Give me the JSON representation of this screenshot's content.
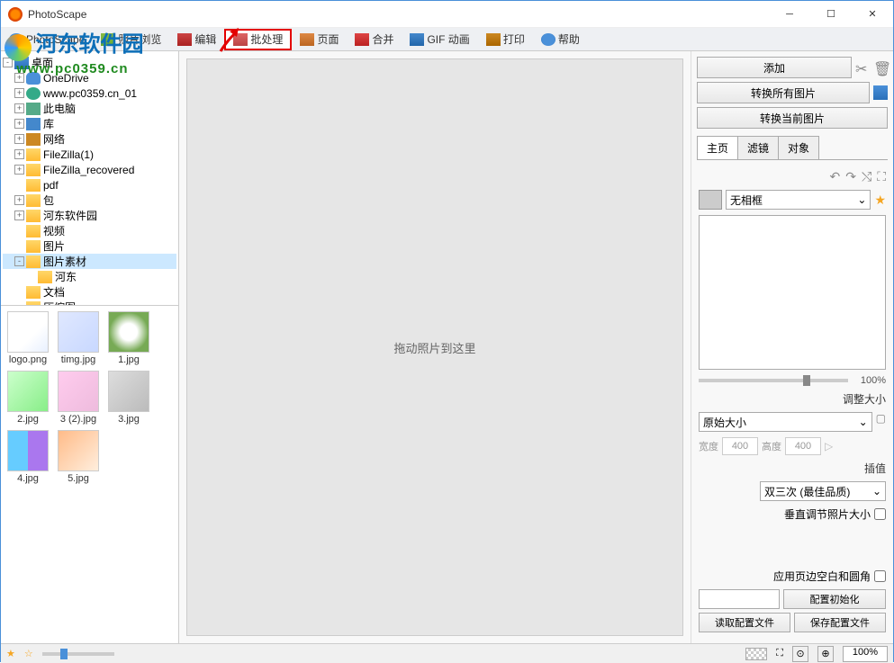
{
  "app": {
    "title": "PhotoScape"
  },
  "watermark": {
    "line1": "河东软件园",
    "line2": "www.pc0359.cn"
  },
  "toolbar": {
    "tabs": [
      {
        "label": "PhotoScape",
        "icon": "globe"
      },
      {
        "label": "照片浏览",
        "icon": "photo"
      },
      {
        "label": "编辑",
        "icon": "edit"
      },
      {
        "label": "批处理",
        "icon": "batch",
        "highlighted": true
      },
      {
        "label": "页面",
        "icon": "page"
      },
      {
        "label": "合并",
        "icon": "merge"
      },
      {
        "label": "GIF 动画",
        "icon": "gif"
      },
      {
        "label": "打印",
        "icon": "print"
      },
      {
        "label": "帮助",
        "icon": "help"
      }
    ]
  },
  "tree": [
    {
      "depth": 0,
      "exp": "-",
      "icon": "desktop",
      "label": "桌面"
    },
    {
      "depth": 1,
      "exp": "+",
      "icon": "cloud",
      "label": "OneDrive"
    },
    {
      "depth": 1,
      "exp": "+",
      "icon": "user",
      "label": "www.pc0359.cn_01"
    },
    {
      "depth": 1,
      "exp": "+",
      "icon": "pc",
      "label": "此电脑"
    },
    {
      "depth": 1,
      "exp": "+",
      "icon": "lib",
      "label": "库"
    },
    {
      "depth": 1,
      "exp": "+",
      "icon": "net",
      "label": "网络"
    },
    {
      "depth": 1,
      "exp": "+",
      "icon": "folder",
      "label": "FileZilla(1)"
    },
    {
      "depth": 1,
      "exp": "+",
      "icon": "folder",
      "label": "FileZilla_recovered"
    },
    {
      "depth": 1,
      "exp": "",
      "icon": "folder",
      "label": "pdf"
    },
    {
      "depth": 1,
      "exp": "+",
      "icon": "folder",
      "label": "包"
    },
    {
      "depth": 1,
      "exp": "+",
      "icon": "folder",
      "label": "河东软件园"
    },
    {
      "depth": 1,
      "exp": "",
      "icon": "folder",
      "label": "视频"
    },
    {
      "depth": 1,
      "exp": "",
      "icon": "folder",
      "label": "图片"
    },
    {
      "depth": 1,
      "exp": "-",
      "icon": "folder",
      "label": "图片素材",
      "selected": true
    },
    {
      "depth": 2,
      "exp": "",
      "icon": "folder",
      "label": "河东"
    },
    {
      "depth": 1,
      "exp": "",
      "icon": "folder",
      "label": "文档"
    },
    {
      "depth": 1,
      "exp": "",
      "icon": "folder",
      "label": "压缩图"
    }
  ],
  "thumbs": [
    {
      "label": "logo.png"
    },
    {
      "label": "timg.jpg"
    },
    {
      "label": "1.jpg"
    },
    {
      "label": "2.jpg"
    },
    {
      "label": "3 (2).jpg"
    },
    {
      "label": "3.jpg"
    },
    {
      "label": "4.jpg"
    },
    {
      "label": "5.jpg"
    }
  ],
  "canvas": {
    "placeholder": "拖动照片到这里"
  },
  "right": {
    "add": "添加",
    "convert_all": "转换所有图片",
    "convert_current": "转换当前图片",
    "subtabs": {
      "home": "主页",
      "filter": "滤镜",
      "object": "对象"
    },
    "frame": {
      "label": "无相框"
    },
    "opacity_value": "100%",
    "resize": {
      "title": "调整大小",
      "mode": "原始大小",
      "width_label": "宽度",
      "width_value": "400",
      "height_label": "高度",
      "height_value": "400"
    },
    "interp": {
      "title": "插值",
      "mode": "双三次 (最佳品质)"
    },
    "vertical_fit": "垂直调节照片大小",
    "apply_margin": "应用页边空白和圆角",
    "config_reset": "配置初始化",
    "config_load": "读取配置文件",
    "config_save": "保存配置文件"
  },
  "status": {
    "zoom": "100%"
  }
}
